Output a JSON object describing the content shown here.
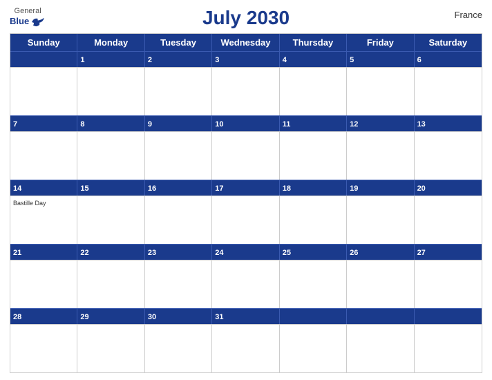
{
  "header": {
    "title": "July 2030",
    "country": "France",
    "logo": {
      "general": "General",
      "blue": "Blue"
    }
  },
  "days_of_week": [
    "Sunday",
    "Monday",
    "Tuesday",
    "Wednesday",
    "Thursday",
    "Friday",
    "Saturday"
  ],
  "weeks": [
    {
      "header_numbers": [
        "",
        "1",
        "2",
        "3",
        "4",
        "5",
        "6"
      ],
      "events": {}
    },
    {
      "header_numbers": [
        "7",
        "8",
        "9",
        "10",
        "11",
        "12",
        "13"
      ],
      "events": {}
    },
    {
      "header_numbers": [
        "14",
        "15",
        "16",
        "17",
        "18",
        "19",
        "20"
      ],
      "events": {
        "0": "Bastille Day"
      }
    },
    {
      "header_numbers": [
        "21",
        "22",
        "23",
        "24",
        "25",
        "26",
        "27"
      ],
      "events": {}
    },
    {
      "header_numbers": [
        "28",
        "29",
        "30",
        "31",
        "",
        "",
        ""
      ],
      "events": {}
    }
  ],
  "colors": {
    "header_bg": "#1a3a8c",
    "header_text": "#ffffff",
    "day_number": "#1a3a8c",
    "border": "#cccccc",
    "bg": "#ffffff"
  }
}
